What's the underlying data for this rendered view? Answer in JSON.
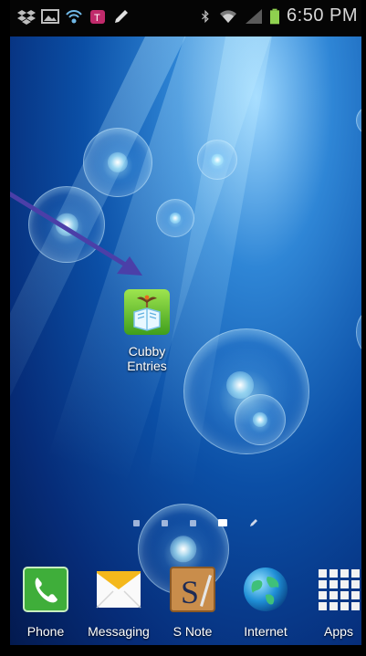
{
  "status_bar": {
    "time": "6:50 PM"
  },
  "home_screen": {
    "shortcut": {
      "label_line1": "Cubby",
      "label_line2": "Entries"
    }
  },
  "dock": {
    "items": [
      {
        "label": "Phone"
      },
      {
        "label": "Messaging"
      },
      {
        "label": "S Note"
      },
      {
        "label": "Internet"
      },
      {
        "label": "Apps"
      }
    ]
  },
  "colors": {
    "arrow": "#4b3fa8",
    "battery": "#8fd14f"
  }
}
